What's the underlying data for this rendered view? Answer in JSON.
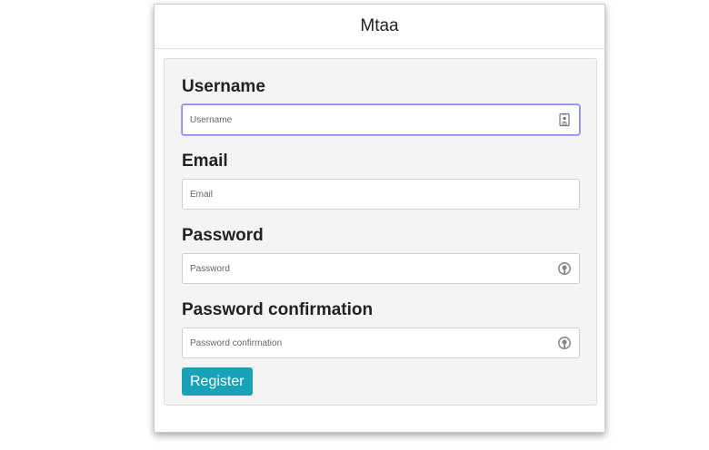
{
  "header": {
    "title": "Mtaa"
  },
  "form": {
    "username": {
      "label": "Username",
      "placeholder": "Username",
      "value": "",
      "icon": "contact-card-icon"
    },
    "email": {
      "label": "Email",
      "placeholder": "Email",
      "value": ""
    },
    "password": {
      "label": "Password",
      "placeholder": "Password",
      "value": "",
      "icon": "password-key-icon"
    },
    "password_confirmation": {
      "label": "Password confirmation",
      "placeholder": "Password confirmation",
      "value": "",
      "icon": "password-key-icon"
    },
    "submit_label": "Register"
  },
  "colors": {
    "accent": "#17a2b8",
    "focus_border": "#8d8bf0",
    "panel_background": "#f4f4f4"
  }
}
